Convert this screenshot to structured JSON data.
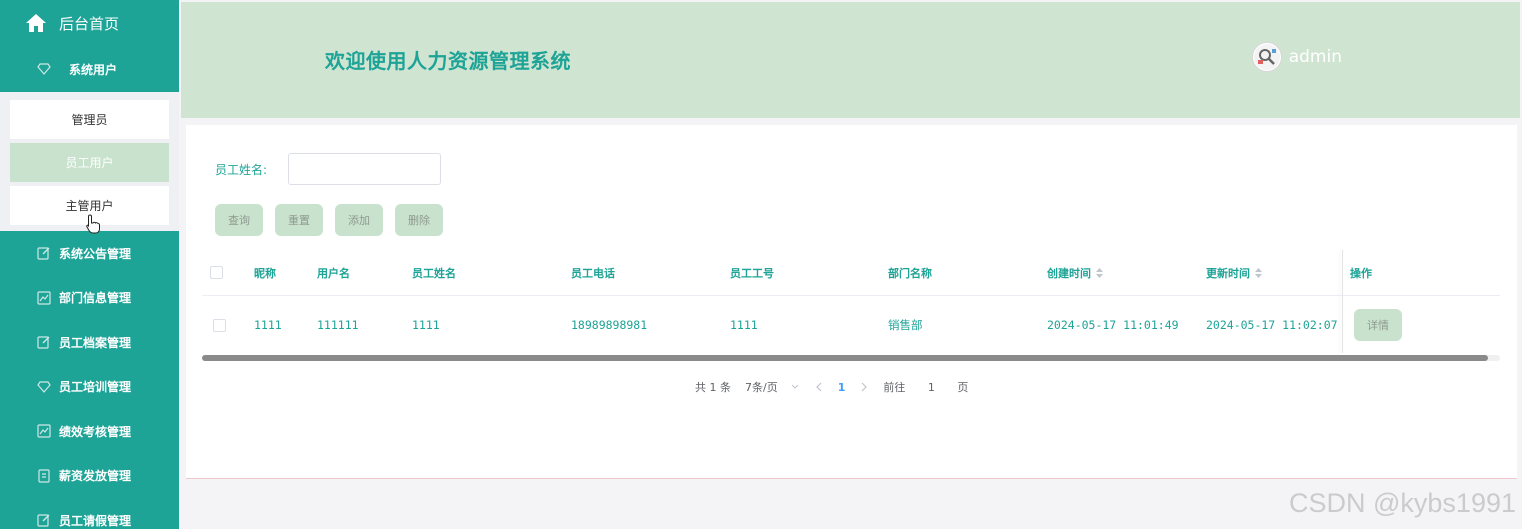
{
  "sidebar": {
    "home": "后台首页",
    "group": "系统用户",
    "sub_items": [
      "管理员",
      "员工用户",
      "主管用户"
    ],
    "items": [
      "系统公告管理",
      "部门信息管理",
      "员工档案管理",
      "员工培训管理",
      "绩效考核管理",
      "薪资发放管理",
      "员工请假管理"
    ]
  },
  "header": {
    "title": "欢迎使用人力资源管理系统",
    "username": "admin"
  },
  "search": {
    "label": "员工姓名:",
    "value": ""
  },
  "buttons": {
    "query": "查询",
    "reset": "重置",
    "add": "添加",
    "delete": "删除"
  },
  "table": {
    "columns": [
      "昵称",
      "用户名",
      "员工姓名",
      "员工电话",
      "员工工号",
      "部门名称",
      "创建时间",
      "更新时间",
      "操作"
    ],
    "rows": [
      {
        "nickname": "1111",
        "username": "111111",
        "name": "1111",
        "phone": "18989898981",
        "employee_no": "1111",
        "department": "销售部",
        "created": "2024-05-17 11:01:49",
        "updated": "2024-05-17 11:02:07",
        "action": "详情"
      }
    ]
  },
  "pagination": {
    "total": "共 1 条",
    "page_size": "7条/页",
    "current": "1",
    "goto_label": "前往",
    "goto_value": "1",
    "page_label": "页"
  },
  "watermark": "CSDN @kybs1991",
  "colors": {
    "primary": "#1ea397",
    "header_bg": "#cfe4d1",
    "button_bg": "#c9e2cd",
    "page_link": "#409eff"
  }
}
